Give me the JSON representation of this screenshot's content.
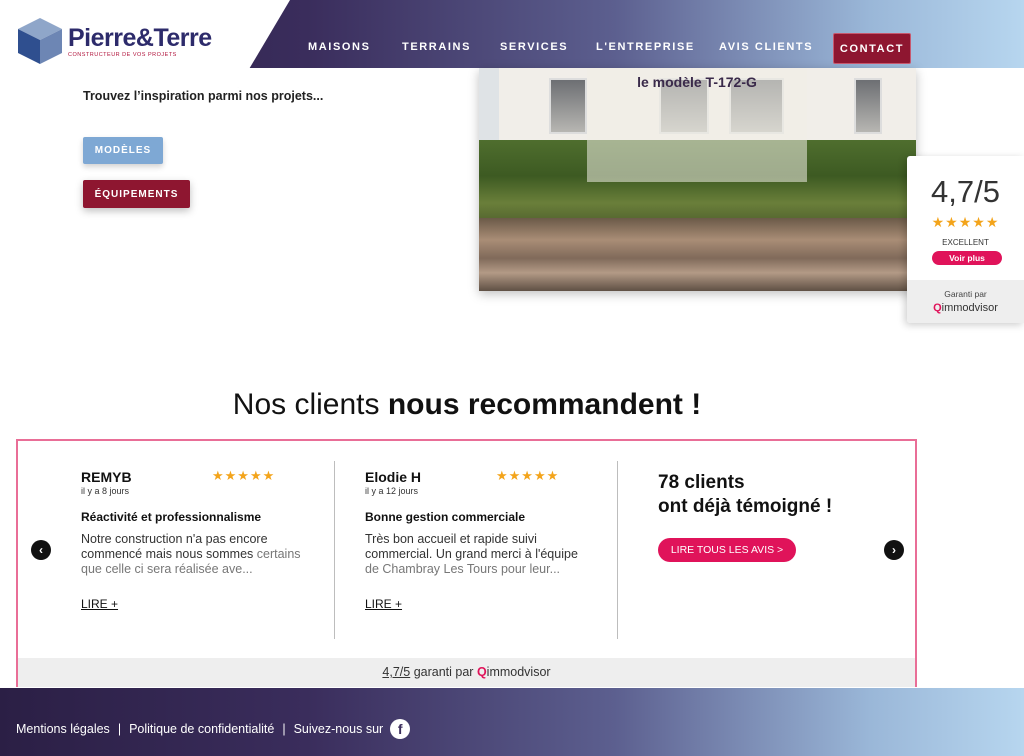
{
  "header": {
    "brand": {
      "name_part1": "Pierre",
      "name_amp": "&",
      "name_part2": "Terre",
      "tagline": "CONSTRUCTEUR DE VOS PROJETS"
    },
    "nav": [
      {
        "label": "MAISONS"
      },
      {
        "label": "TERRAINS"
      },
      {
        "label": "SERVICES"
      },
      {
        "label": "L'ENTREPRISE"
      },
      {
        "label": "AVIS CLIENTS"
      }
    ],
    "contact_label": "CONTACT"
  },
  "intro": {
    "text": "Trouvez l’inspiration parmi nos projets...",
    "btn_models": "MODÈLES",
    "btn_equipments": "ÉQUIPEMENTS"
  },
  "hero": {
    "caption": "le modèle T-172-G"
  },
  "rating_widget": {
    "score": "4,7/5",
    "stars": "★★★★★",
    "label": "EXCELLENT",
    "button": "Voir plus",
    "guarantee": "Garanti par",
    "brand": "immodvisor"
  },
  "section": {
    "title_part1": "Nos clients ",
    "title_part2": "nous recommandent !"
  },
  "reviews": [
    {
      "name": "REMYB",
      "date": "il y a 8 jours",
      "stars": "★★★★★",
      "title": "Réactivité et professionnalisme",
      "text": "Notre construction n'a pas encore commencé mais nous sommes",
      "text_fade": "certains que celle ci sera réalisée ave...",
      "more": "LIRE +"
    },
    {
      "name": "Elodie H",
      "date": "il y a 12 jours",
      "stars": "★★★★★",
      "title": "Bonne gestion commerciale",
      "text": "Très bon accueil et rapide suivi commercial. Un grand merci à l'équipe",
      "text_fade": "de Chambray Les Tours pour leur...",
      "more": "LIRE +"
    }
  ],
  "clients": {
    "line1": "78 clients",
    "line2": "ont déjà témoigné !",
    "button": "LIRE TOUS LES AVIS >"
  },
  "reviews_footer": {
    "score": "4,7/5",
    "text": " garanti par ",
    "brand": "immodvisor"
  },
  "footer": {
    "legal": "Mentions légales",
    "privacy": "Politique de confidentialité",
    "follow": "Suivez-nous sur",
    "separator": "|"
  },
  "colors": {
    "brand_purple": "#2d2b6b",
    "brand_red": "#8e1630",
    "accent_pink": "#e0135a",
    "light_blue": "#7ea8d4",
    "star": "#f3a41b"
  },
  "icons": {
    "arrow_left": "chevron-left-icon",
    "arrow_right": "chevron-right-icon",
    "facebook": "facebook-icon",
    "logo": "cube-logo-icon"
  }
}
